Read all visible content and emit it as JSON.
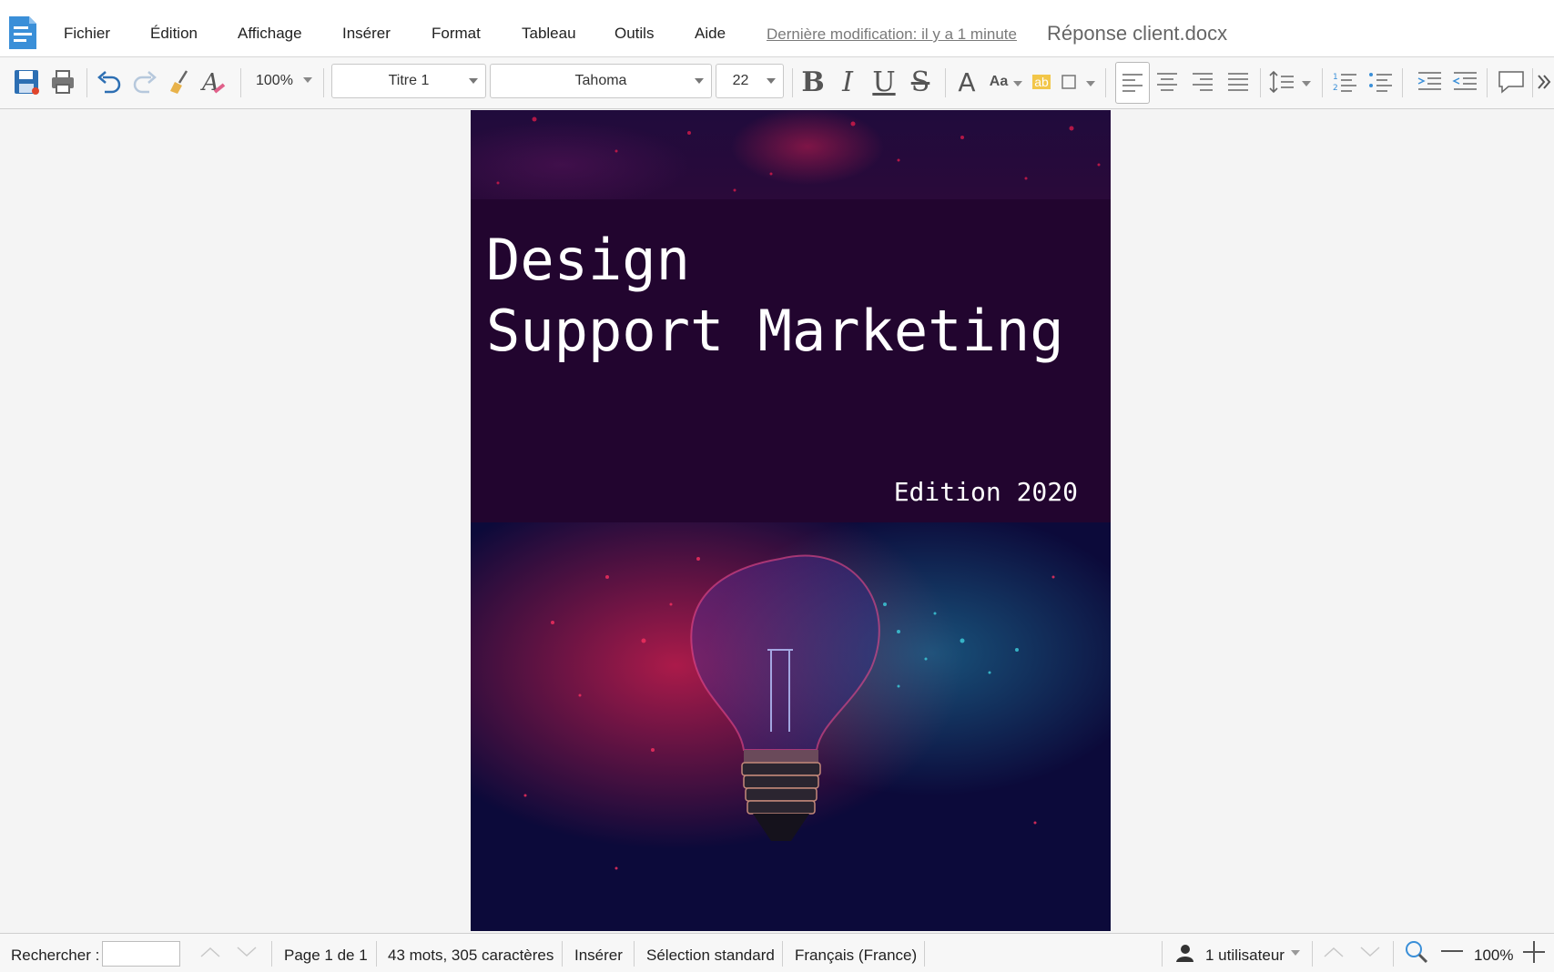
{
  "menu": {
    "items": [
      "Fichier",
      "Édition",
      "Affichage",
      "Insérer",
      "Format",
      "Tableau",
      "Outils",
      "Aide"
    ],
    "last_modified": "Dernière modification: il y a 1 minute",
    "document_title": "Réponse client.docx"
  },
  "toolbar": {
    "zoom": "100%",
    "style": "Titre 1",
    "font": "Tahoma",
    "size": "22",
    "bold": "B",
    "italic": "I",
    "underline": "U",
    "strike": "S",
    "font_color_glyph": "A",
    "case_glyph": "Aa",
    "highlight_glyph": "ab"
  },
  "document": {
    "title_line1": "Design",
    "title_line2": "Support Marketing",
    "edition": "Edition 2020"
  },
  "status": {
    "search_label": "Rechercher :",
    "search_value": "",
    "page": "Page 1 de 1",
    "words": "43 mots, 305 caractères",
    "mode": "Insérer",
    "selection": "Sélection standard",
    "language": "Français (France)",
    "users": "1 utilisateur",
    "zoom": "100%"
  },
  "colors": {
    "accent_blue": "#3a8fd8",
    "title_bg": "#22052f",
    "photo_bg": "#0c0a3a"
  }
}
